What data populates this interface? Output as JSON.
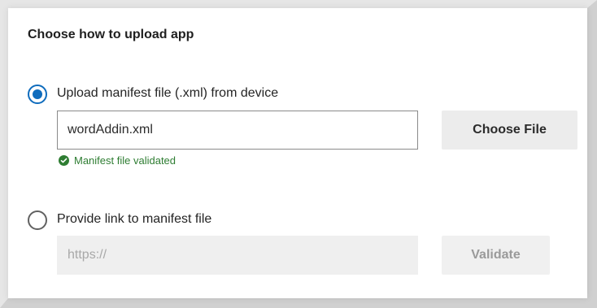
{
  "dialog": {
    "title": "Choose how to upload app"
  },
  "options": {
    "upload": {
      "label": "Upload manifest file (.xml) from device",
      "selected": true,
      "file_value": "wordAddin.xml",
      "choose_button": "Choose File",
      "status_text": "Manifest file validated",
      "status_icon": "check-circle-icon",
      "status_color": "#2e7d32"
    },
    "link": {
      "label": "Provide link to manifest file",
      "selected": false,
      "placeholder": "https://",
      "validate_button": "Validate"
    }
  },
  "colors": {
    "accent": "#0f6cbd"
  }
}
